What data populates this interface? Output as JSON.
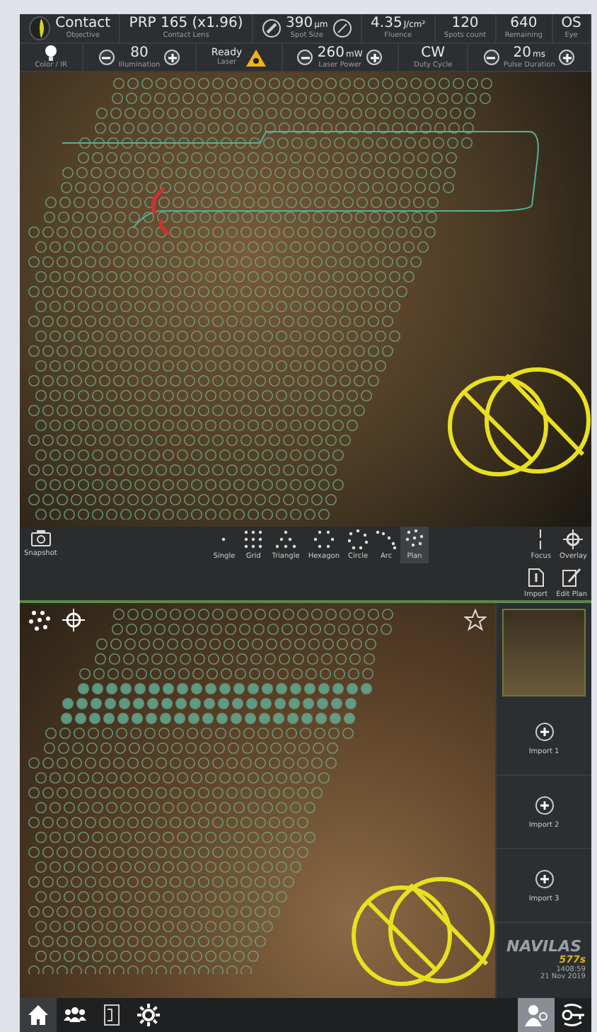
{
  "header": {
    "row_1": [
      {
        "kind": "objective",
        "value": "Contact",
        "label": "Objective"
      },
      {
        "kind": "plain",
        "value": "PRP 165 (x1.96)",
        "label": "Contact Lens"
      },
      {
        "kind": "spot",
        "value": "390",
        "unit": "µm",
        "label": "Spot Size"
      },
      {
        "kind": "plain",
        "value": "4.35",
        "unit": "J/cm²",
        "label": "Fluence"
      },
      {
        "kind": "plain",
        "value": "120",
        "label": "Spots count"
      },
      {
        "kind": "plain",
        "value": "640",
        "label": "Remaining"
      },
      {
        "kind": "plain",
        "value": "OS",
        "label": "Eye"
      }
    ],
    "row_2": [
      {
        "kind": "color",
        "label": "Color / IR"
      },
      {
        "kind": "stepper",
        "value": "80",
        "label": "Illumination"
      },
      {
        "kind": "status",
        "value": "Ready",
        "label": "Laser"
      },
      {
        "kind": "stepper",
        "value": "260",
        "unit": "mW",
        "label": "Laser Power"
      },
      {
        "kind": "plain",
        "value": "CW",
        "label": "Duty Cycle"
      },
      {
        "kind": "stepper",
        "value": "20",
        "unit": "ms",
        "label": "Pulse Duration"
      }
    ]
  },
  "toolbar": {
    "snapshot": "Snapshot",
    "patterns": [
      {
        "label": "Single",
        "selected": false
      },
      {
        "label": "Grid",
        "selected": false
      },
      {
        "label": "Triangle",
        "selected": false
      },
      {
        "label": "Hexagon",
        "selected": false
      },
      {
        "label": "Circle",
        "selected": false
      },
      {
        "label": "Arc",
        "selected": false
      },
      {
        "label": "Plan",
        "selected": true
      }
    ],
    "tools": [
      {
        "kind": "focus",
        "label": "Focus"
      },
      {
        "kind": "overlay",
        "label": "Overlay"
      }
    ],
    "plan_tools": [
      {
        "kind": "import",
        "label": "Import"
      },
      {
        "kind": "edit",
        "label": "Edit Plan"
      }
    ]
  },
  "side_panel": {
    "imports": [
      "Import 1",
      "Import 2",
      "Import 3"
    ],
    "logo": "NAVILAS",
    "model": "577s",
    "time": "1408:59",
    "date": "21 Nov 2019"
  },
  "nav": [
    {
      "kind": "home",
      "selected": true
    },
    {
      "kind": "patients",
      "selected": false
    },
    {
      "kind": "document",
      "selected": false
    },
    {
      "kind": "settings",
      "selected": false
    }
  ]
}
